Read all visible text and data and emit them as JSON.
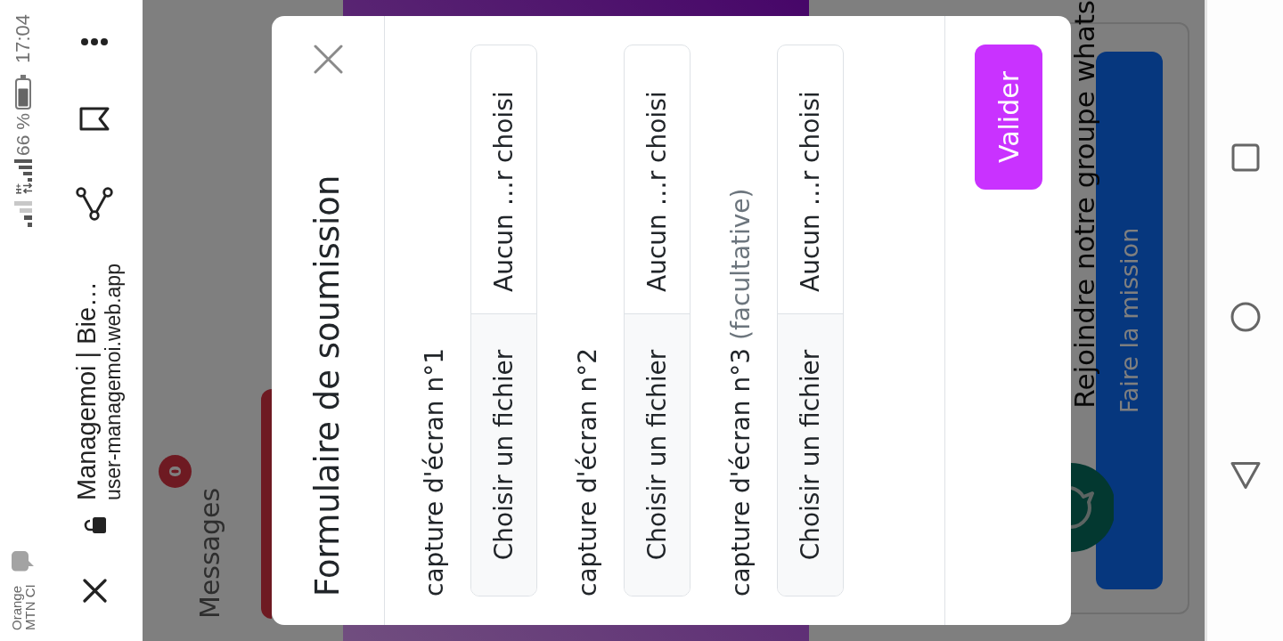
{
  "status_bar": {
    "carrier": [
      "Orange",
      "MTN CI"
    ],
    "network_type": "H+",
    "battery": "66 %",
    "time": "17:04"
  },
  "browser_toolbar": {
    "title": "Managemoi | Bie…",
    "url": "user-managemoi.web.app"
  },
  "page": {
    "tab": {
      "label": "Messages",
      "badge": "0"
    },
    "whatsapp_tooltip": "Rejoindre notre groupe whats",
    "mission_button": "Faire la mission"
  },
  "modal": {
    "title": "Formulaire de soumission",
    "fields": [
      {
        "label": "capture d'écran n°1",
        "button": "Choisir un fichier",
        "file_name": "Aucun …r choisi"
      },
      {
        "label": "capture d'écran n°2",
        "button": "Choisir un fichier",
        "file_name": "Aucun …r choisi"
      },
      {
        "label": "capture d'écran n°3",
        "note": "(facultative)",
        "button": "Choisir un fichier",
        "file_name": "Aucun …r choisi"
      }
    ],
    "submit": "Valider"
  }
}
